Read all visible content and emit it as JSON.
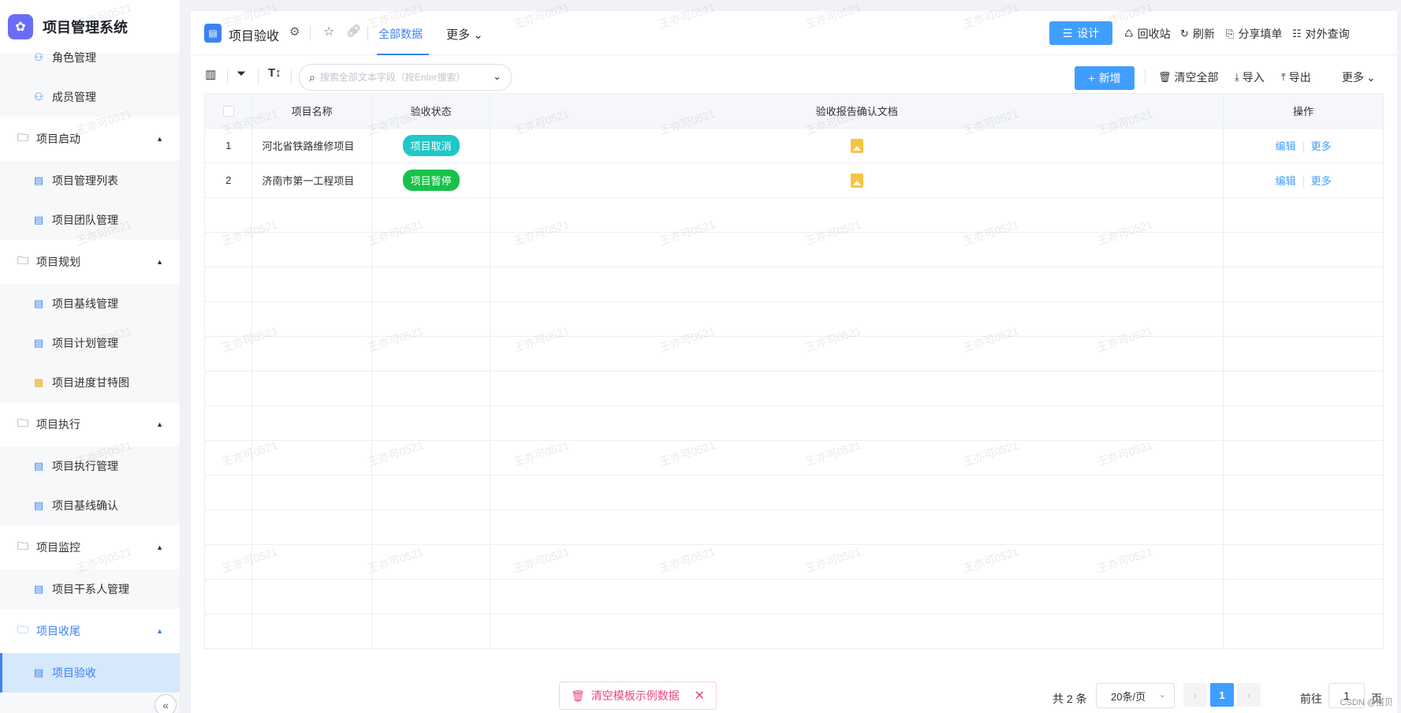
{
  "app": {
    "title": "项目管理系统"
  },
  "sidebar": {
    "items": [
      {
        "type": "item",
        "label": "角色管理",
        "name": "sidebar-item-roles",
        "icon": "user-icon"
      },
      {
        "type": "item",
        "label": "成员管理",
        "name": "sidebar-item-members",
        "icon": "user-icon"
      },
      {
        "type": "group",
        "label": "项目启动",
        "name": "sidebar-group-start"
      },
      {
        "type": "item",
        "label": "项目管理列表",
        "name": "sidebar-item-project-list",
        "icon": "document-icon"
      },
      {
        "type": "item",
        "label": "项目团队管理",
        "name": "sidebar-item-team",
        "icon": "document-icon"
      },
      {
        "type": "group",
        "label": "项目规划",
        "name": "sidebar-group-plan"
      },
      {
        "type": "item",
        "label": "项目基线管理",
        "name": "sidebar-item-baseline",
        "icon": "document-icon"
      },
      {
        "type": "item",
        "label": "项目计划管理",
        "name": "sidebar-item-plan",
        "icon": "document-icon"
      },
      {
        "type": "item",
        "label": "项目进度甘特图",
        "name": "sidebar-item-gantt",
        "icon": "chart-icon"
      },
      {
        "type": "group",
        "label": "项目执行",
        "name": "sidebar-group-exec"
      },
      {
        "type": "item",
        "label": "项目执行管理",
        "name": "sidebar-item-exec",
        "icon": "document-icon"
      },
      {
        "type": "item",
        "label": "项目基线确认",
        "name": "sidebar-item-baseline-confirm",
        "icon": "document-icon"
      },
      {
        "type": "group",
        "label": "项目监控",
        "name": "sidebar-group-monitor"
      },
      {
        "type": "item",
        "label": "项目干系人管理",
        "name": "sidebar-item-stakeholder",
        "icon": "document-icon"
      },
      {
        "type": "group",
        "label": "项目收尾",
        "name": "sidebar-group-close",
        "active": true
      },
      {
        "type": "item",
        "label": "项目验收",
        "name": "sidebar-item-acceptance",
        "icon": "document-icon",
        "active": true
      }
    ]
  },
  "header": {
    "title": "项目验收",
    "tab_all": "全部数据",
    "tab_more": "更多",
    "design": "设计",
    "recycle": "回收站",
    "refresh": "刷新",
    "share": "分享填单",
    "external": "对外查询"
  },
  "toolbar": {
    "search_placeholder": "搜索全部文本字段（按Enter搜索）",
    "add": "新增",
    "clear_all": "清空全部",
    "import": "导入",
    "export": "导出",
    "more": "更多"
  },
  "table": {
    "columns": [
      "项目名称",
      "验收状态",
      "验收报告确认文档",
      "操作"
    ],
    "rows": [
      {
        "index": "1",
        "name": "河北省铁路维修项目",
        "status": "项目取消",
        "status_color": "#1fc7c7",
        "edit": "编辑",
        "more": "更多"
      },
      {
        "index": "2",
        "name": "济南市第一工程项目",
        "status": "项目暂停",
        "status_color": "#19c14a",
        "edit": "编辑",
        "more": "更多"
      }
    ],
    "empty_rows": 13
  },
  "footer": {
    "clear_demo": "清空模板示例数据",
    "total": "共 2 条",
    "page_size": "20条/页",
    "current_page": "1",
    "goto": "前往",
    "goto_value": "1",
    "page_suffix": "页"
  },
  "watermark": "王亦可0521",
  "credit": "CSDN @搭贝",
  "colors": {
    "primary": "#409eff",
    "accent": "#3b82f6",
    "danger": "#f0447a"
  }
}
